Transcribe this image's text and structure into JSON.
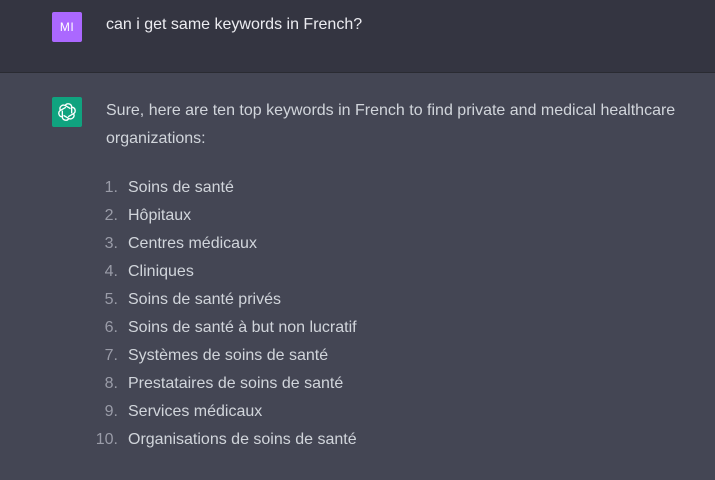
{
  "user_message": {
    "avatar_initials": "MI",
    "text": "can i get same keywords in French?"
  },
  "assistant_message": {
    "icon": "openai-logo-icon",
    "intro": "Sure, here are ten top keywords in French to find private and medical healthcare organizations:",
    "keywords": [
      {
        "number": "1.",
        "text": "Soins de santé"
      },
      {
        "number": "2.",
        "text": "Hôpitaux"
      },
      {
        "number": "3.",
        "text": "Centres médicaux"
      },
      {
        "number": "4.",
        "text": "Cliniques"
      },
      {
        "number": "5.",
        "text": "Soins de santé privés"
      },
      {
        "number": "6.",
        "text": "Soins de santé à but non lucratif"
      },
      {
        "number": "7.",
        "text": "Systèmes de soins de santé"
      },
      {
        "number": "8.",
        "text": "Prestataires de soins de santé"
      },
      {
        "number": "9.",
        "text": "Services médicaux"
      },
      {
        "number": "10.",
        "text": "Organisations de soins de santé"
      }
    ]
  },
  "colors": {
    "user_bg": "#343541",
    "assistant_bg": "#444654",
    "avatar_bg": "#ab68ff",
    "bot_icon_bg": "#10a37f"
  }
}
